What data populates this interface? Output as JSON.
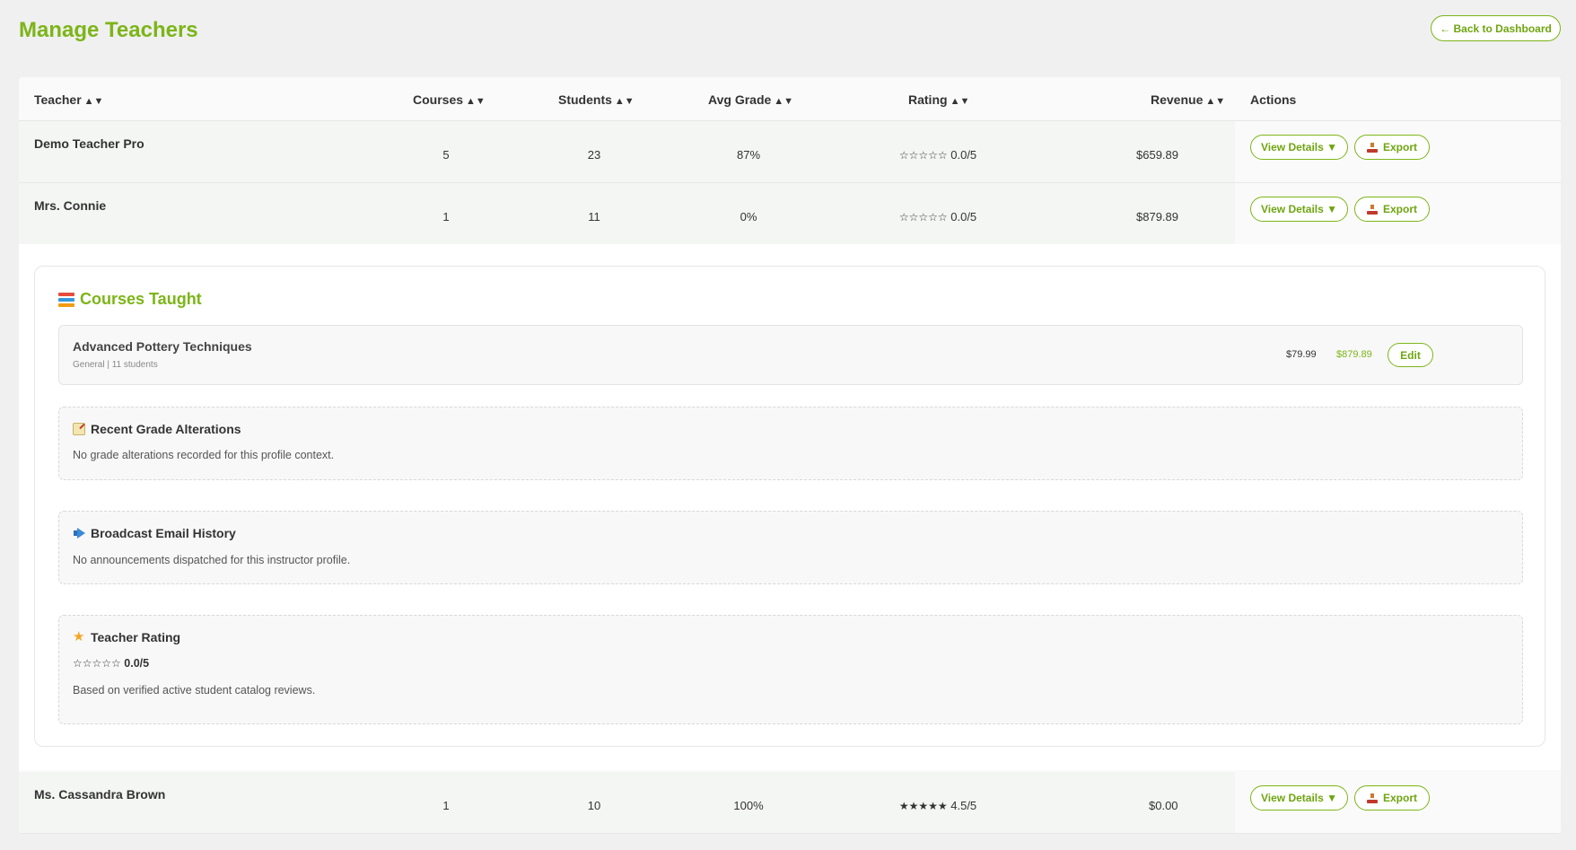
{
  "header": {
    "title": "Manage Teachers",
    "back_label": "← Back to Dashboard"
  },
  "table": {
    "columns": {
      "teacher": "Teacher",
      "courses": "Courses",
      "students": "Students",
      "avg_grade": "Avg Grade",
      "rating": "Rating",
      "revenue": "Revenue",
      "actions": "Actions"
    },
    "sort_glyph": "▲▼",
    "view_details_label": "View Details ▼",
    "export_label": "Export",
    "rows": [
      {
        "name": "Demo Teacher Pro",
        "courses": "5",
        "students": "23",
        "avg_grade": "87%",
        "stars": "☆☆☆☆☆",
        "rating": "0.0/5",
        "revenue": "$659.89"
      },
      {
        "name": "Mrs. Connie",
        "courses": "1",
        "students": "11",
        "avg_grade": "0%",
        "stars": "☆☆☆☆☆",
        "rating": "0.0/5",
        "revenue": "$879.89"
      },
      {
        "name": "Ms. Cassandra Brown",
        "courses": "1",
        "students": "10",
        "avg_grade": "100%",
        "stars": "★★★★★",
        "rating": "4.5/5",
        "revenue": "$0.00"
      }
    ]
  },
  "details": {
    "courses_title": "Courses Taught",
    "course": {
      "name": "Advanced Pottery Techniques",
      "meta": "General | 11 students",
      "price": "$79.99",
      "revenue": "$879.89",
      "edit_label": "Edit"
    },
    "grade_alterations": {
      "title": "Recent Grade Alterations",
      "text": "No grade alterations recorded for this profile context."
    },
    "broadcast": {
      "title": "Broadcast Email History",
      "text": "No announcements dispatched for this instructor profile."
    },
    "rating": {
      "title": "Teacher Rating",
      "stars": "☆☆☆☆☆",
      "value": "0.0/5",
      "text": "Based on verified active student catalog reviews."
    }
  },
  "colors": {
    "accent": "#7cb518",
    "background": "#f0f0f0",
    "row_bg": "#f3f6f3"
  }
}
